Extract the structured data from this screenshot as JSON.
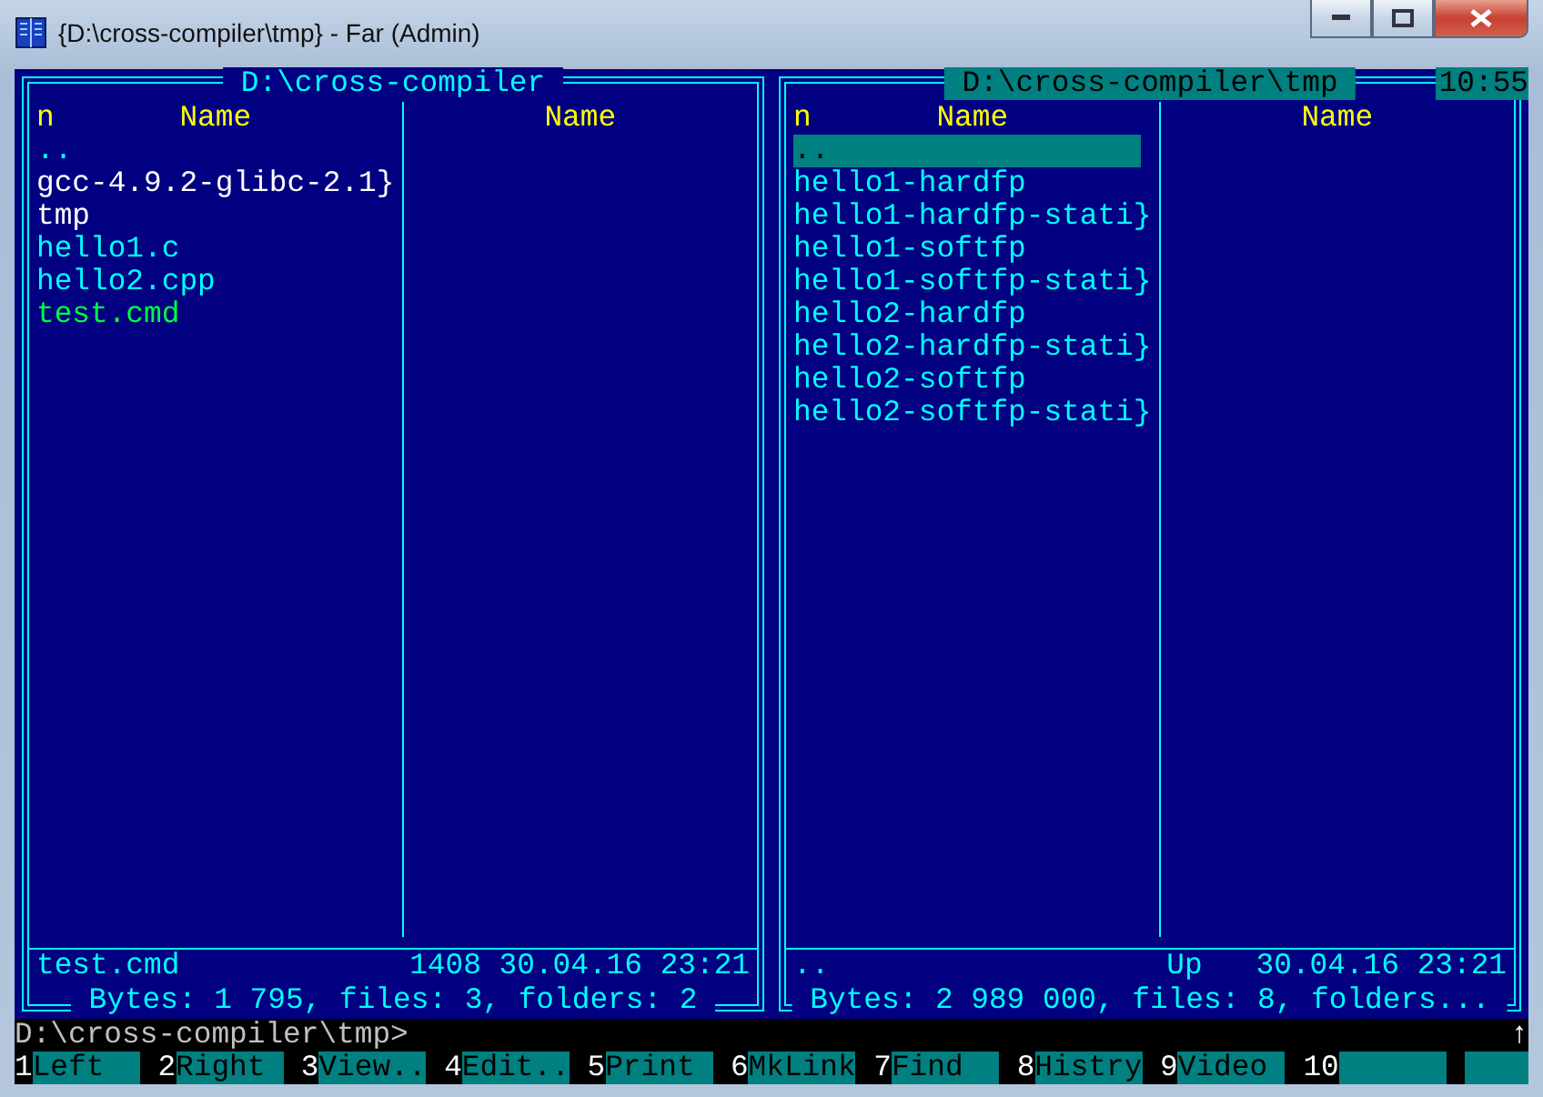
{
  "window": {
    "title": "{D:\\cross-compiler\\tmp} - Far (Admin)"
  },
  "clock": "10:55",
  "panels": [
    {
      "title": "D:\\cross-compiler",
      "active": false,
      "sort_mark": "n",
      "column_names": [
        "Name",
        "Name"
      ],
      "files": [
        {
          "name": "..",
          "kind": "up",
          "selected": false
        },
        {
          "name": "gcc-4.9.2-glibc-2.1}",
          "kind": "dir",
          "selected": false
        },
        {
          "name": "tmp",
          "kind": "dir",
          "selected": false
        },
        {
          "name": "hello1.c",
          "kind": "file",
          "selected": false
        },
        {
          "name": "hello2.cpp",
          "kind": "file",
          "selected": false
        },
        {
          "name": "test.cmd",
          "kind": "exec",
          "selected": false
        }
      ],
      "status": {
        "name": "test.cmd",
        "size": "1408",
        "date": "30.04.16",
        "time": "23:21"
      },
      "summary": "Bytes: 1 795, files: 3, folders: 2"
    },
    {
      "title": "D:\\cross-compiler\\tmp",
      "active": true,
      "sort_mark": "n",
      "column_names": [
        "Name",
        "Name"
      ],
      "files": [
        {
          "name": "..",
          "kind": "up",
          "selected": true
        },
        {
          "name": "hello1-hardfp",
          "kind": "file",
          "selected": false
        },
        {
          "name": "hello1-hardfp-stati}",
          "kind": "file",
          "selected": false
        },
        {
          "name": "hello1-softfp",
          "kind": "file",
          "selected": false
        },
        {
          "name": "hello1-softfp-stati}",
          "kind": "file",
          "selected": false
        },
        {
          "name": "hello2-hardfp",
          "kind": "file",
          "selected": false
        },
        {
          "name": "hello2-hardfp-stati}",
          "kind": "file",
          "selected": false
        },
        {
          "name": "hello2-softfp",
          "kind": "file",
          "selected": false
        },
        {
          "name": "hello2-softfp-stati}",
          "kind": "file",
          "selected": false
        }
      ],
      "status": {
        "name": "..",
        "size": "Up",
        "date": "30.04.16",
        "time": "23:21"
      },
      "summary": "Bytes: 2 989 000, files: 8, folders..."
    }
  ],
  "command_line": {
    "prompt": "D:\\cross-compiler\\tmp>",
    "scroll_indicator": "↑"
  },
  "keybar": [
    {
      "key": "1",
      "label": "Left"
    },
    {
      "key": "2",
      "label": "Right"
    },
    {
      "key": "3",
      "label": "View.."
    },
    {
      "key": "4",
      "label": "Edit.."
    },
    {
      "key": "5",
      "label": "Print"
    },
    {
      "key": "6",
      "label": "MkLink"
    },
    {
      "key": "7",
      "label": "Find"
    },
    {
      "key": "8",
      "label": "Histry"
    },
    {
      "key": "9",
      "label": "Video"
    },
    {
      "key": "10"
    }
  ]
}
